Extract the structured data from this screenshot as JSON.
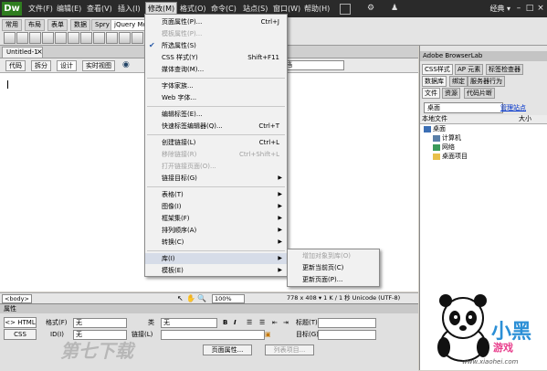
{
  "app": {
    "logo": "Dw",
    "menus": [
      "文件(F)",
      "编辑(E)",
      "查看(V)",
      "插入(I)",
      "修改(M)",
      "格式(O)",
      "命令(C)",
      "站点(S)",
      "窗口(W)",
      "帮助(H)"
    ],
    "classic": "经典 ▾"
  },
  "insert_bar": {
    "tabs": [
      "常用",
      "布局",
      "表单",
      "数据",
      "Spry",
      "jQuery Mob"
    ]
  },
  "document": {
    "tab_label": "Untitled-1",
    "view_buttons": [
      "代码",
      "拆分",
      "设计",
      "实时视图"
    ],
    "title_label": "标题",
    "title_value": "文档",
    "tag_selector": "<body>",
    "zoom": "100%",
    "size_info": "778 x 408 ▾ 1 K / 1 秒 Unicode (UTF-8)"
  },
  "properties": {
    "header": "属性",
    "html_btn": "<> HTML",
    "css_btn": "CSS",
    "format_label": "格式(F)",
    "format_value": "无",
    "id_label": "ID(I)",
    "id_value": "无",
    "class_label": "类",
    "class_value": "无",
    "link_label": "链接(L)",
    "title_label": "标题(T)",
    "target_label": "目标(G)",
    "page_props_btn": "页面属性...",
    "list_item_btn": "列表项目..."
  },
  "right_panel": {
    "header1": "Adobe BrowserLab",
    "tabs1": [
      "CSS样式",
      "AP 元素",
      "标签检查器"
    ],
    "tabs2": [
      "数据库",
      "绑定",
      "服务器行为"
    ],
    "tabs3": [
      "文件",
      "资源",
      "代码片断"
    ],
    "site_select": "桌面",
    "manage_link": "管理站点",
    "tree_col1": "本地文件",
    "tree_col2": "大小",
    "tree": [
      "桌面",
      "计算机",
      "网络",
      "桌面项目"
    ]
  },
  "dropdown": {
    "items": [
      {
        "label": "页面属性(P)...",
        "shortcut": "Ctrl+J"
      },
      {
        "label": "模板属性(P)...",
        "disabled": true
      },
      {
        "label": "所选属性(S)",
        "checked": true
      },
      {
        "label": "CSS 样式(Y)",
        "shortcut": "Shift+F11"
      },
      {
        "label": "媒体查询(M)..."
      },
      {
        "label": "字体家族..."
      },
      {
        "label": "Web 字体..."
      },
      {
        "label": "编辑标签(E)..."
      },
      {
        "label": "快速标签编辑器(Q)...",
        "shortcut": "Ctrl+T"
      },
      {
        "label": "创建链接(L)",
        "shortcut": "Ctrl+L"
      },
      {
        "label": "移除链接(R)",
        "shortcut": "Ctrl+Shift+L",
        "disabled": true
      },
      {
        "label": "打开链接页面(O)...",
        "disabled": true
      },
      {
        "label": "链接目标(G)",
        "submenu": true
      },
      {
        "label": "表格(T)",
        "submenu": true
      },
      {
        "label": "图像(I)",
        "submenu": true
      },
      {
        "label": "框架集(F)",
        "submenu": true
      },
      {
        "label": "排列顺序(A)",
        "submenu": true
      },
      {
        "label": "转换(C)",
        "submenu": true
      },
      {
        "label": "库(I)",
        "submenu": true,
        "highlighted": true
      },
      {
        "label": "模板(E)",
        "submenu": true
      }
    ],
    "submenu": [
      {
        "label": "增加对象到库(O)",
        "disabled": true
      },
      {
        "label": "更新当前页(C)"
      },
      {
        "label": "更新页面(P)..."
      }
    ]
  },
  "watermark": {
    "left_text": "第七下载",
    "brand": "小黑",
    "brand2": "游戏",
    "url": "www.xiaohei.com"
  }
}
